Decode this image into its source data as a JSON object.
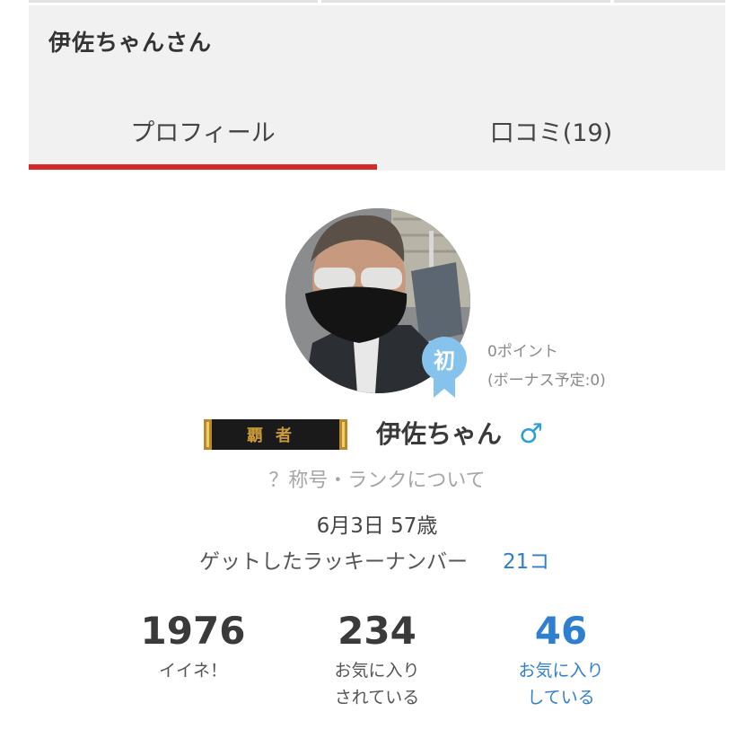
{
  "header": {
    "title": "伊佐ちゃんさん"
  },
  "tabs": [
    {
      "label": "プロフィール",
      "active": true
    },
    {
      "label": "口コミ(19)",
      "active": false
    }
  ],
  "profile": {
    "badge_label": "初",
    "points": "0ポイント",
    "bonus": "(ボーナス予定:0)",
    "rank_title": "覇者",
    "username": "伊佐ちゃん",
    "gender_symbol": "♂",
    "rank_link": "？称号・ランクについて",
    "birthday_age": "6月3日 57歳",
    "lucky_label": "ゲットしたラッキーナンバー",
    "lucky_count": "21コ"
  },
  "stats": [
    {
      "value": "1976",
      "label_line1": "イイネ！",
      "label_line2": ""
    },
    {
      "value": "234",
      "label_line1": "お気に入り",
      "label_line2": "されている"
    },
    {
      "value": "46",
      "label_line1": "お気に入り",
      "label_line2": "している"
    }
  ],
  "colors": {
    "accent_red": "#d32a2a",
    "link_blue": "#2f7fd0",
    "gender_blue": "#2b9fd6",
    "badge_blue": "#86c3ec"
  }
}
